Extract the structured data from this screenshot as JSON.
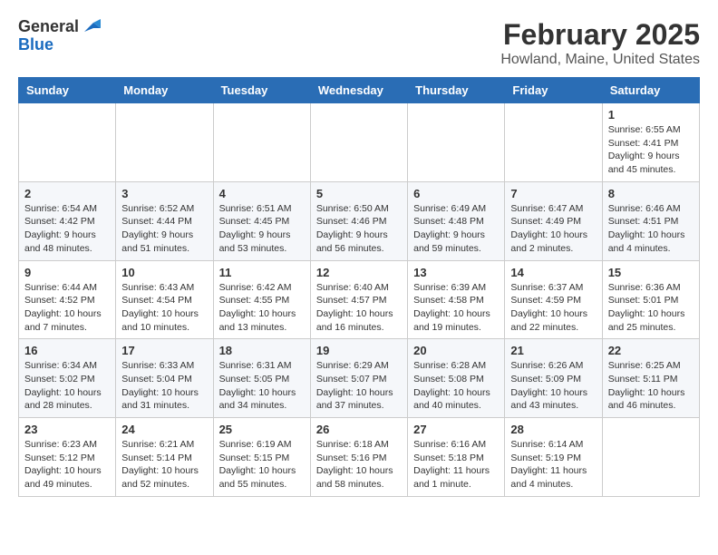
{
  "logo": {
    "line1": "General",
    "line2": "Blue"
  },
  "title": {
    "month_year": "February 2025",
    "location": "Howland, Maine, United States"
  },
  "days_of_week": [
    "Sunday",
    "Monday",
    "Tuesday",
    "Wednesday",
    "Thursday",
    "Friday",
    "Saturday"
  ],
  "weeks": [
    [
      {
        "day": "",
        "detail": ""
      },
      {
        "day": "",
        "detail": ""
      },
      {
        "day": "",
        "detail": ""
      },
      {
        "day": "",
        "detail": ""
      },
      {
        "day": "",
        "detail": ""
      },
      {
        "day": "",
        "detail": ""
      },
      {
        "day": "1",
        "detail": "Sunrise: 6:55 AM\nSunset: 4:41 PM\nDaylight: 9 hours and 45 minutes."
      }
    ],
    [
      {
        "day": "2",
        "detail": "Sunrise: 6:54 AM\nSunset: 4:42 PM\nDaylight: 9 hours and 48 minutes."
      },
      {
        "day": "3",
        "detail": "Sunrise: 6:52 AM\nSunset: 4:44 PM\nDaylight: 9 hours and 51 minutes."
      },
      {
        "day": "4",
        "detail": "Sunrise: 6:51 AM\nSunset: 4:45 PM\nDaylight: 9 hours and 53 minutes."
      },
      {
        "day": "5",
        "detail": "Sunrise: 6:50 AM\nSunset: 4:46 PM\nDaylight: 9 hours and 56 minutes."
      },
      {
        "day": "6",
        "detail": "Sunrise: 6:49 AM\nSunset: 4:48 PM\nDaylight: 9 hours and 59 minutes."
      },
      {
        "day": "7",
        "detail": "Sunrise: 6:47 AM\nSunset: 4:49 PM\nDaylight: 10 hours and 2 minutes."
      },
      {
        "day": "8",
        "detail": "Sunrise: 6:46 AM\nSunset: 4:51 PM\nDaylight: 10 hours and 4 minutes."
      }
    ],
    [
      {
        "day": "9",
        "detail": "Sunrise: 6:44 AM\nSunset: 4:52 PM\nDaylight: 10 hours and 7 minutes."
      },
      {
        "day": "10",
        "detail": "Sunrise: 6:43 AM\nSunset: 4:54 PM\nDaylight: 10 hours and 10 minutes."
      },
      {
        "day": "11",
        "detail": "Sunrise: 6:42 AM\nSunset: 4:55 PM\nDaylight: 10 hours and 13 minutes."
      },
      {
        "day": "12",
        "detail": "Sunrise: 6:40 AM\nSunset: 4:57 PM\nDaylight: 10 hours and 16 minutes."
      },
      {
        "day": "13",
        "detail": "Sunrise: 6:39 AM\nSunset: 4:58 PM\nDaylight: 10 hours and 19 minutes."
      },
      {
        "day": "14",
        "detail": "Sunrise: 6:37 AM\nSunset: 4:59 PM\nDaylight: 10 hours and 22 minutes."
      },
      {
        "day": "15",
        "detail": "Sunrise: 6:36 AM\nSunset: 5:01 PM\nDaylight: 10 hours and 25 minutes."
      }
    ],
    [
      {
        "day": "16",
        "detail": "Sunrise: 6:34 AM\nSunset: 5:02 PM\nDaylight: 10 hours and 28 minutes."
      },
      {
        "day": "17",
        "detail": "Sunrise: 6:33 AM\nSunset: 5:04 PM\nDaylight: 10 hours and 31 minutes."
      },
      {
        "day": "18",
        "detail": "Sunrise: 6:31 AM\nSunset: 5:05 PM\nDaylight: 10 hours and 34 minutes."
      },
      {
        "day": "19",
        "detail": "Sunrise: 6:29 AM\nSunset: 5:07 PM\nDaylight: 10 hours and 37 minutes."
      },
      {
        "day": "20",
        "detail": "Sunrise: 6:28 AM\nSunset: 5:08 PM\nDaylight: 10 hours and 40 minutes."
      },
      {
        "day": "21",
        "detail": "Sunrise: 6:26 AM\nSunset: 5:09 PM\nDaylight: 10 hours and 43 minutes."
      },
      {
        "day": "22",
        "detail": "Sunrise: 6:25 AM\nSunset: 5:11 PM\nDaylight: 10 hours and 46 minutes."
      }
    ],
    [
      {
        "day": "23",
        "detail": "Sunrise: 6:23 AM\nSunset: 5:12 PM\nDaylight: 10 hours and 49 minutes."
      },
      {
        "day": "24",
        "detail": "Sunrise: 6:21 AM\nSunset: 5:14 PM\nDaylight: 10 hours and 52 minutes."
      },
      {
        "day": "25",
        "detail": "Sunrise: 6:19 AM\nSunset: 5:15 PM\nDaylight: 10 hours and 55 minutes."
      },
      {
        "day": "26",
        "detail": "Sunrise: 6:18 AM\nSunset: 5:16 PM\nDaylight: 10 hours and 58 minutes."
      },
      {
        "day": "27",
        "detail": "Sunrise: 6:16 AM\nSunset: 5:18 PM\nDaylight: 11 hours and 1 minute."
      },
      {
        "day": "28",
        "detail": "Sunrise: 6:14 AM\nSunset: 5:19 PM\nDaylight: 11 hours and 4 minutes."
      },
      {
        "day": "",
        "detail": ""
      }
    ]
  ]
}
